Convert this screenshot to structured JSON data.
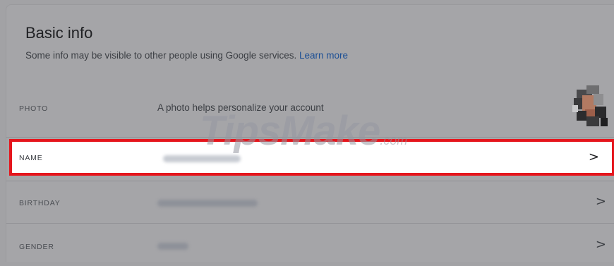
{
  "section": {
    "title": "Basic info",
    "subtitle": "Some info may be visible to other people using Google services.",
    "learn_more": "Learn more"
  },
  "rows": {
    "photo": {
      "label": "PHOTO",
      "value": "A photo helps personalize your account"
    },
    "name": {
      "label": "NAME",
      "chevron": ">"
    },
    "birthday": {
      "label": "BIRTHDAY",
      "chevron": ">"
    },
    "gender": {
      "label": "GENDER",
      "chevron": ">"
    }
  },
  "watermark": {
    "text": "TipsMake",
    "suffix": ".com"
  },
  "colors": {
    "highlight_border": "#e5151c",
    "link": "#1c4f95"
  }
}
